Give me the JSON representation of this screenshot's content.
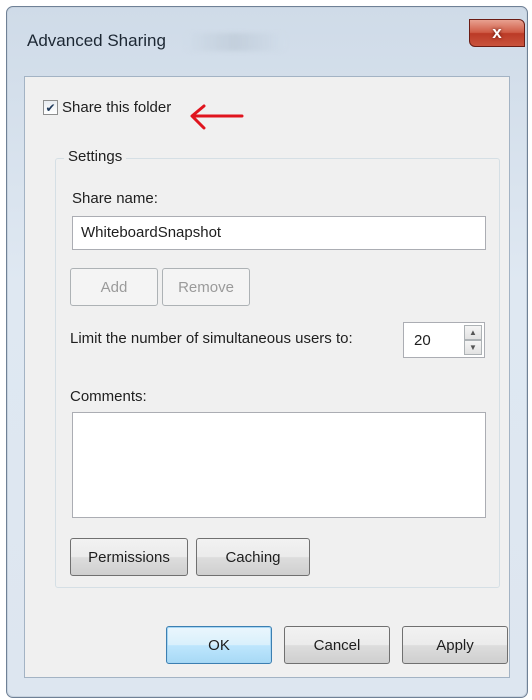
{
  "window": {
    "title": "Advanced Sharing",
    "close_label": "x"
  },
  "share_checkbox": {
    "label": "Share this folder",
    "checked": true
  },
  "settings": {
    "group_label": "Settings",
    "share_name_label": "Share name:",
    "share_name_value": "WhiteboardSnapshot",
    "add_label": "Add",
    "remove_label": "Remove",
    "limit_label": "Limit the number of simultaneous users to:",
    "limit_value": "20",
    "comments_label": "Comments:",
    "comments_value": "",
    "permissions_label": "Permissions",
    "caching_label": "Caching"
  },
  "footer": {
    "ok_label": "OK",
    "cancel_label": "Cancel",
    "apply_label": "Apply"
  },
  "annotation": {
    "arrow_color": "#e0141e"
  }
}
